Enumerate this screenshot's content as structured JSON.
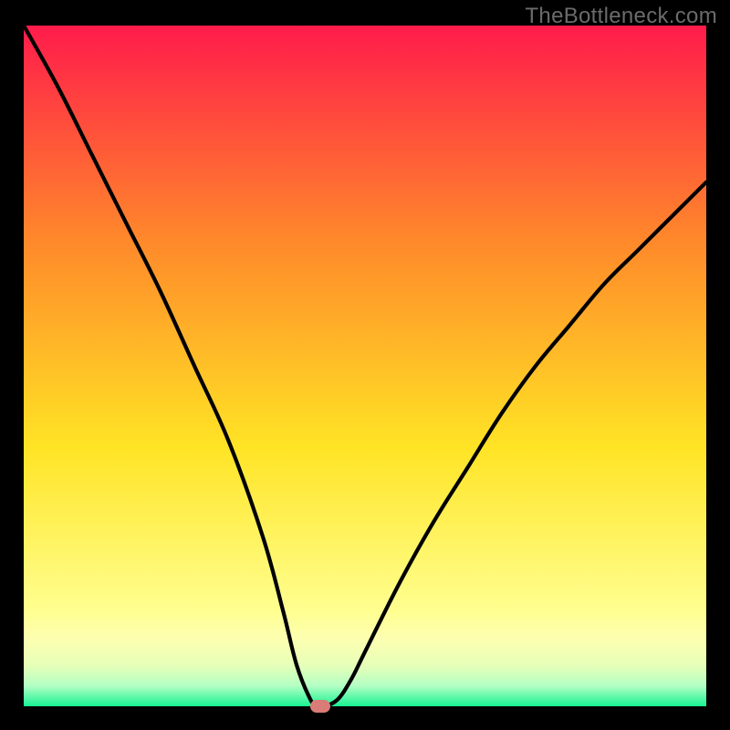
{
  "attribution": "TheBottleneck.com",
  "colors": {
    "top": "#ff1b4b",
    "mid_upper": "#ff8a2a",
    "mid": "#ffe425",
    "mid_lower": "#ffff90",
    "band1": "#fdffb0",
    "band2": "#e7ffb8",
    "band3": "#b3ffc4",
    "bottom": "#17f393",
    "curve": "#000000",
    "marker": "#d97b76",
    "frame": "#000000"
  },
  "chart_data": {
    "type": "line",
    "title": "",
    "xlabel": "",
    "ylabel": "",
    "xlim": [
      0,
      100
    ],
    "ylim": [
      0,
      100
    ],
    "series": [
      {
        "name": "bottleneck-curve",
        "x": [
          0,
          5,
          10,
          15,
          20,
          25,
          30,
          35,
          38,
          40,
          42,
          43,
          44,
          46,
          48,
          50,
          55,
          60,
          65,
          70,
          75,
          80,
          85,
          90,
          95,
          100
        ],
        "values": [
          100,
          91,
          81,
          71,
          61,
          50,
          39,
          25,
          14,
          6,
          1,
          0,
          0,
          1,
          4,
          8,
          18,
          27,
          35,
          43,
          50,
          56,
          62,
          67,
          72,
          77
        ]
      }
    ],
    "annotations": [
      {
        "name": "optimal-marker",
        "x": 43.5,
        "y": 0,
        "shape": "pill",
        "color": "#d97b76"
      }
    ],
    "background_gradient": {
      "stops": [
        {
          "offset": 0.0,
          "color": "#ff1b4b"
        },
        {
          "offset": 0.32,
          "color": "#ff8a2a"
        },
        {
          "offset": 0.62,
          "color": "#ffe425"
        },
        {
          "offset": 0.86,
          "color": "#ffff90"
        },
        {
          "offset": 0.9,
          "color": "#fdffb0"
        },
        {
          "offset": 0.94,
          "color": "#e7ffb8"
        },
        {
          "offset": 0.97,
          "color": "#b3ffc4"
        },
        {
          "offset": 1.0,
          "color": "#17f393"
        }
      ]
    }
  }
}
